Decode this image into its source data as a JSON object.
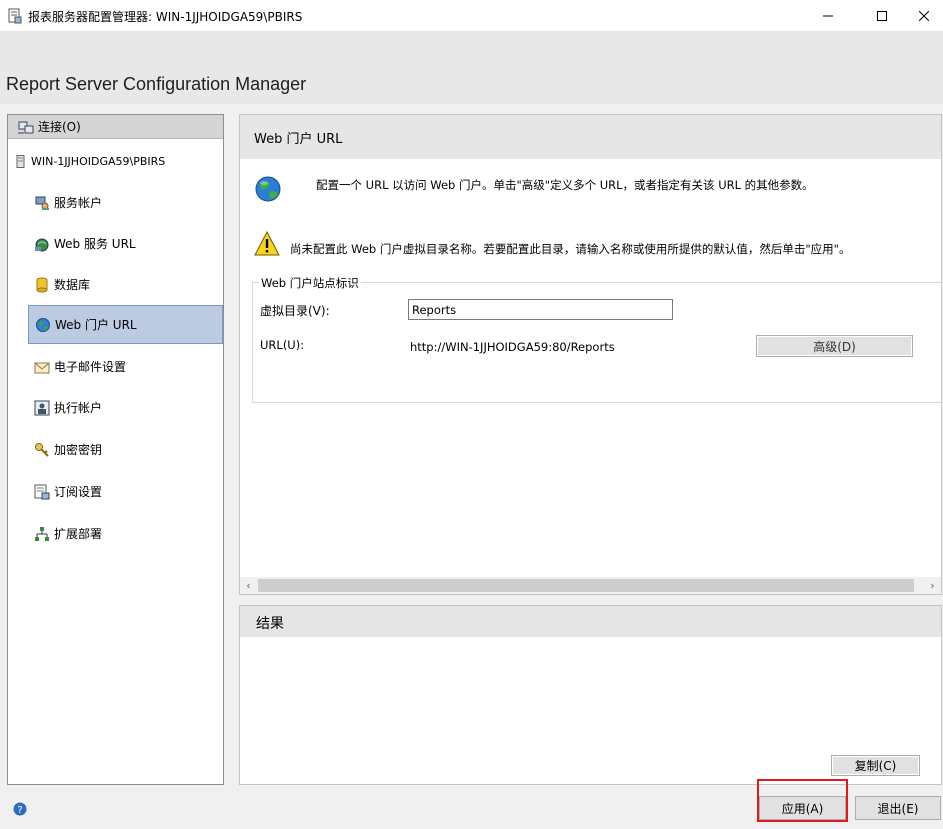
{
  "window": {
    "title": "报表服务器配置管理器: WIN-1JJHOIDGA59\\PBIRS",
    "app_title": "Report Server Configuration Manager"
  },
  "nav": {
    "connect_label": "连接(O)",
    "server_label": "WIN-1JJHOIDGA59\\PBIRS",
    "items": [
      {
        "label": "服务帐户",
        "icon": "service-account-icon"
      },
      {
        "label": "Web 服务 URL",
        "icon": "web-service-icon"
      },
      {
        "label": "数据库",
        "icon": "database-icon"
      },
      {
        "label": "Web 门户 URL",
        "icon": "globe-icon",
        "active": true
      },
      {
        "label": "电子邮件设置",
        "icon": "email-icon"
      },
      {
        "label": "执行帐户",
        "icon": "execution-account-icon"
      },
      {
        "label": "加密密钥",
        "icon": "key-icon"
      },
      {
        "label": "订阅设置",
        "icon": "subscription-icon"
      },
      {
        "label": "扩展部署",
        "icon": "scale-out-icon"
      }
    ]
  },
  "main": {
    "heading": "Web 门户 URL",
    "info_text": "配置一个 URL 以访问 Web 门户。单击\"高级\"定义多个 URL，或者指定有关该 URL 的其他参数。",
    "warning_text": "尚未配置此 Web 门户虚拟目录名称。若要配置此目录，请输入名称或使用所提供的默认值，然后单击\"应用\"。",
    "group_label": "Web 门户站点标识",
    "vdir_label": "虚拟目录(V):",
    "vdir_value": "Reports",
    "url_label": "URL(U):",
    "url_value": "http://WIN-1JJHOIDGA59:80/Reports",
    "advanced_label": "高级(D)"
  },
  "results": {
    "heading": "结果",
    "copy_label": "复制(C)"
  },
  "footer": {
    "apply_label": "应用(A)",
    "exit_label": "退出(E)"
  },
  "colors": {
    "highlight": "#e0191e",
    "nav_active": "#bccbe2"
  }
}
